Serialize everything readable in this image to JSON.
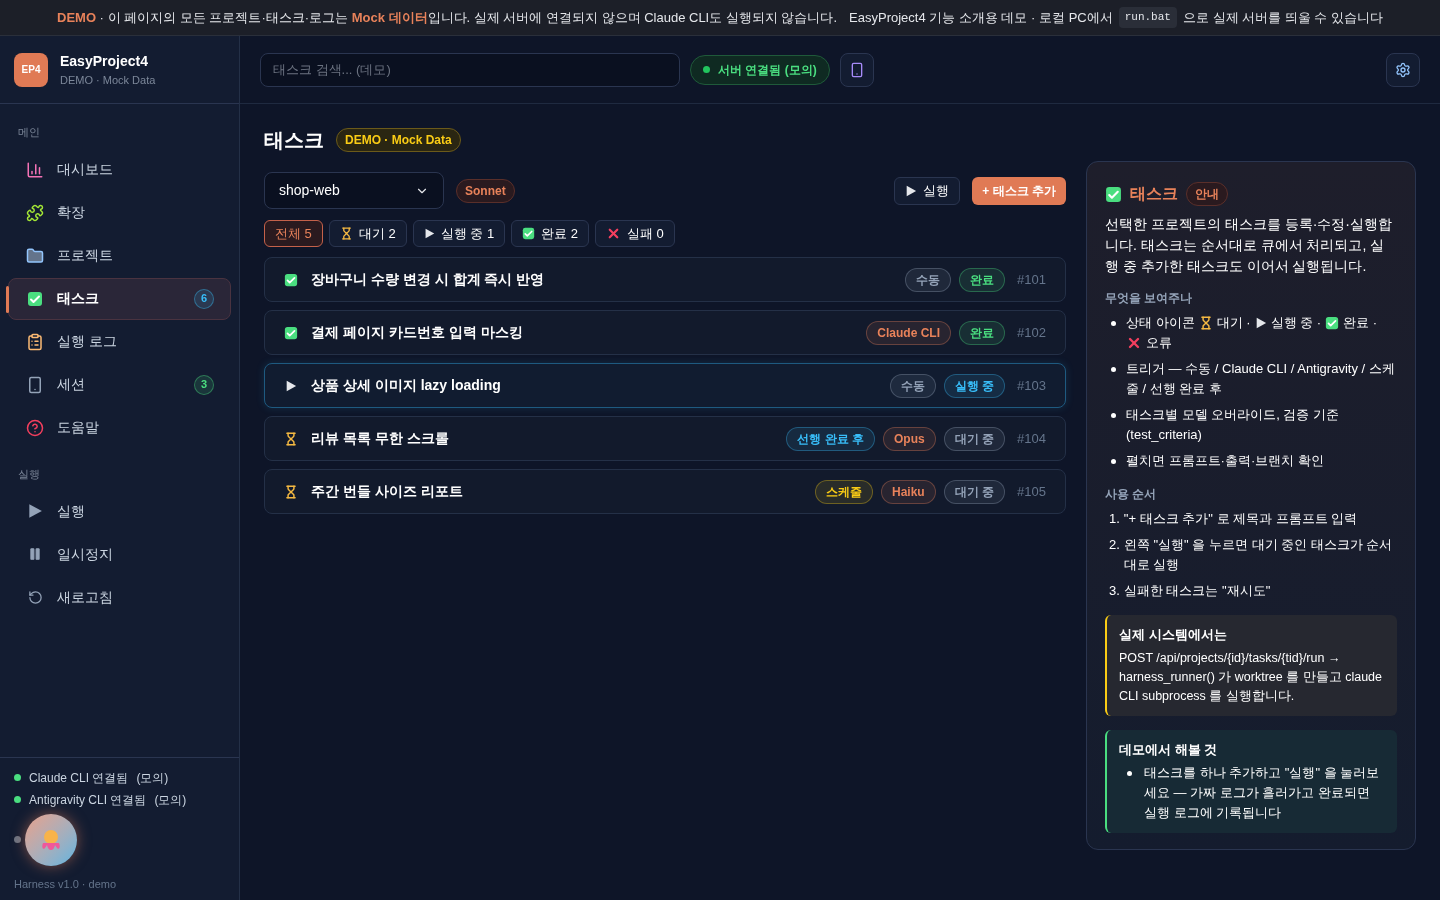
{
  "banner": {
    "notice": "**DEMO** · 이 페이지의 모든 프로젝트·태스크·로그는 **Mock 데이터**입니다. 실제 서버에 연결되지 않으며 Claude CLI도 실행되지 않습니다.",
    "info_before": "EasyProject4 기능 소개용 데모 · 로컬 PC에서",
    "code": "run.bat",
    "info_after": "으로 실제 서버를 띄울 수 있습니다"
  },
  "brand": {
    "logo": "EP4",
    "name": "EasyProject4",
    "subtitle": "DEMO · Mock Data"
  },
  "sidebar": {
    "sections": [
      {
        "title": "메인",
        "items": [
          {
            "label": "대시보드",
            "kind": "chart",
            "selected": false
          },
          {
            "label": "확장",
            "kind": "puzzle",
            "selected": false
          },
          {
            "label": "프로젝트",
            "kind": "folder",
            "selected": false
          },
          {
            "label": "태스크",
            "kind": "check",
            "selected": true,
            "count": "6",
            "color": "#38bdf8"
          },
          {
            "label": "실행 로그",
            "kind": "clipboard",
            "selected": false
          },
          {
            "label": "세션",
            "kind": "phone",
            "selected": false,
            "count": "3",
            "color": "#4ade80"
          },
          {
            "label": "도움말",
            "kind": "help",
            "selected": false
          }
        ]
      },
      {
        "title": "실행",
        "items": [
          {
            "label": "실행",
            "kind": "play",
            "selected": false
          },
          {
            "label": "일시정지",
            "kind": "pause",
            "selected": false
          },
          {
            "label": "새로고침",
            "kind": "refresh",
            "selected": false
          }
        ]
      }
    ],
    "status": [
      {
        "label": "Claude CLI 연결됨",
        "note": "(모의)",
        "color": "#4ade80"
      },
      {
        "label": "Antigravity CLI 연결됨",
        "note": "(모의)",
        "color": "#4ade80"
      },
      {
        "color": "#6b7280"
      }
    ],
    "version": "Harness v1.0 · demo"
  },
  "topbar": {
    "search": {
      "placeholder": "태스크 검색... (데모)"
    },
    "server": {
      "label": "서버 연결됨 (모의)",
      "color": "#22c55e"
    }
  },
  "page": {
    "title": "태스크",
    "badge": "DEMO · Mock Data",
    "project": "shop-web",
    "model": "Sonnet",
    "run_button": "실행",
    "add_button": "+ 태스크 추가",
    "filters": [
      {
        "kind": "all",
        "label": "전체 5",
        "selected": true
      },
      {
        "kind": "hourglass",
        "label": "대기 2",
        "selected": false
      },
      {
        "kind": "play",
        "label": "실행 중 1",
        "selected": false
      },
      {
        "kind": "check",
        "label": "완료 2",
        "selected": false
      },
      {
        "kind": "cross",
        "label": "실패 0",
        "selected": false
      }
    ],
    "tasks": [
      {
        "kind": "check",
        "selected": false,
        "title": "장바구니 수량 변경 시 합계 즉시 반영",
        "tags": [
          {
            "label": "수동",
            "color": "#94a3b8"
          },
          {
            "label": "완료",
            "color": "#4ade80"
          }
        ],
        "id": "#101"
      },
      {
        "kind": "check",
        "selected": false,
        "title": "결제 페이지 카드번호 입력 마스킹",
        "tags": [
          {
            "label": "Claude CLI",
            "color": "#e8825a"
          },
          {
            "label": "완료",
            "color": "#4ade80"
          }
        ],
        "id": "#102"
      },
      {
        "kind": "play",
        "selected": true,
        "title": "상품 상세 이미지 lazy loading",
        "tags": [
          {
            "label": "수동",
            "color": "#94a3b8"
          },
          {
            "label": "실행 중",
            "color": "#38bdf8"
          }
        ],
        "id": "#103"
      },
      {
        "kind": "hourglass",
        "selected": false,
        "title": "리뷰 목록 무한 스크롤",
        "tags": [
          {
            "label": "선행 완료 후",
            "color": "#38bdf8"
          },
          {
            "label": "Opus",
            "color": "#e8825a"
          },
          {
            "label": "대기 중",
            "color": "#94a3b8"
          }
        ],
        "id": "#104"
      },
      {
        "kind": "hourglass",
        "selected": false,
        "title": "주간 번들 사이즈 리포트",
        "tags": [
          {
            "label": "스케줄",
            "color": "#facc15"
          },
          {
            "label": "Haiku",
            "color": "#e8825a"
          },
          {
            "label": "대기 중",
            "color": "#94a3b8"
          }
        ],
        "id": "#105"
      }
    ]
  },
  "help": {
    "title": "태스크",
    "badge": "안내",
    "intro": "선택한 프로젝트의 태스크를 등록·수정·실행합니다. 태스크는 순서대로 큐에서 처리되고, 실행 중 추가한 태스크도 이어서 실행됩니다.",
    "shows_title": "무엇을 보여주나",
    "shows": [
      [
        {
          "kind": "text",
          "text": "상태 아이콘"
        },
        {
          "kind": "hourglass"
        },
        {
          "kind": "text",
          "text": "대기 ·"
        },
        {
          "kind": "play"
        },
        {
          "kind": "text",
          "text": "실행 중 ·"
        },
        {
          "kind": "check"
        },
        {
          "kind": "text",
          "text": "완료 ·"
        },
        {
          "kind": "cross"
        },
        {
          "kind": "text",
          "text": "오류"
        }
      ],
      [
        {
          "kind": "text",
          "text": "트리거 — 수동 / Claude CLI / Antigravity / 스케줄 / 선행 완료 후"
        }
      ],
      [
        {
          "kind": "text",
          "text": "태스크별 모델 오버라이드, 검증 기준 (test_criteria)"
        }
      ],
      [
        {
          "kind": "text",
          "text": "펼치면 프롬프트·출력·브랜치 확인"
        }
      ]
    ],
    "steps_title": "사용 순서",
    "steps": [
      {
        "number": "1.",
        "text": "\"+ 태스크 추가\" 로 제목과 프롬프트 입력"
      },
      {
        "number": "2.",
        "text": "왼쪽 \"실행\" 을 누르면 대기 중인 태스크가 순서대로 실행"
      },
      {
        "number": "3.",
        "text": "실패한 태스크는 \"재시도\""
      }
    ],
    "notes": [
      {
        "title": "실제 시스템에서는",
        "body": "POST /api/projects/{id}/tasks/{tid}/run → harness_runner() 가 worktree 를 만들고 claude CLI subprocess 를 실행합니다.",
        "color": "#facc15"
      },
      {
        "title": "데모에서 해볼 것",
        "bullets": [
          "태스크를 하나 추가하고 \"실행\" 을 눌러보세요 — 가짜 로그가 흘러가고 완료되면 실행 로그에 기록됩니다"
        ],
        "color": "#4ade80"
      }
    ]
  }
}
